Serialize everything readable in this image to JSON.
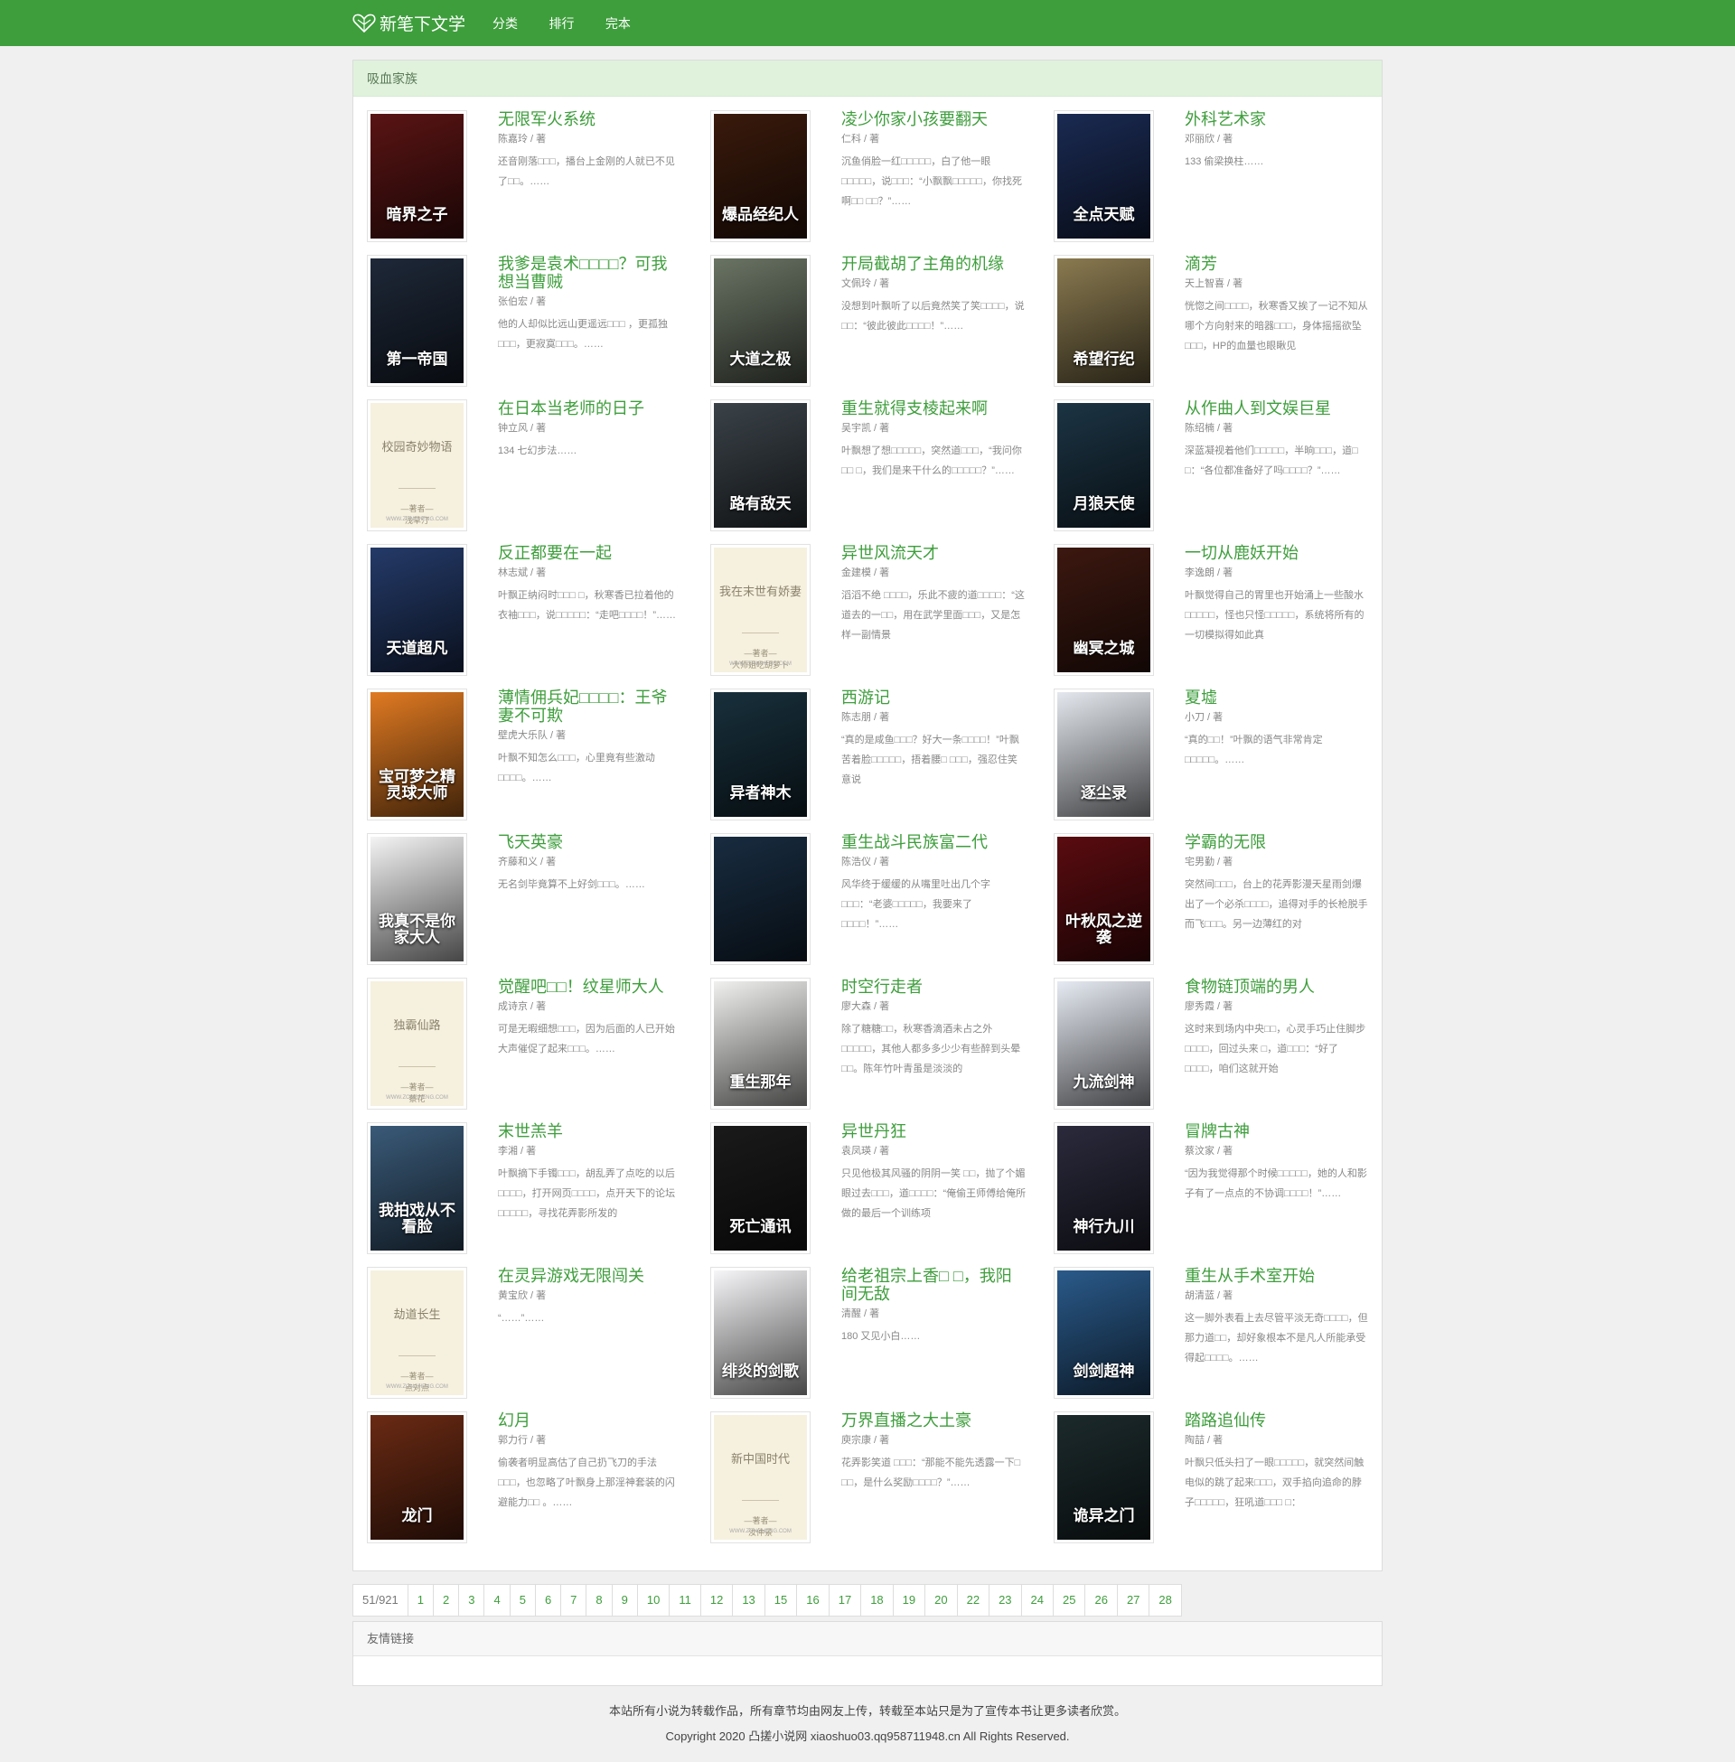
{
  "brand": {
    "name": "新笔下文学",
    "icon": "book-heart-logo-icon"
  },
  "nav": [
    "分类",
    "排行",
    "完本"
  ],
  "panel_title": "吸血家族",
  "books": [
    {
      "title": "无限军火系统",
      "author": "陈嘉玲 / 著",
      "desc": "还音刚落□□□，播台上金刚的人就已不见了□□。……",
      "cover": {
        "type": "image",
        "text": "暗界之子",
        "bg": "#5a1414"
      }
    },
    {
      "title": "凌少你家小孩要翻天",
      "author": "仁科 / 著",
      "desc": "沉鱼俏脸一红□□□□□，白了他一眼□□□□□，说□□□：“小飘飘□□□□□，你找死啊□□ □□？”……",
      "cover": {
        "type": "image",
        "text": "爆品经纪人",
        "bg": "#3a1a0c"
      }
    },
    {
      "title": "外科艺术家",
      "author": "邓丽欣 / 著",
      "desc": "133 偷梁换柱……",
      "cover": {
        "type": "image",
        "text": "全点天赋",
        "bg": "#1a2a52"
      }
    },
    {
      "title": "我爹是袁术□□□□？可我想当曹贼",
      "author": "张伯宏 / 著",
      "desc": "他的人却似比远山更遥远□□□ ，更孤独□□□，更寂寞□□□。……",
      "cover": {
        "type": "image",
        "text": "第一帝国",
        "bg": "#1e2838"
      }
    },
    {
      "title": "开局截胡了主角的机缘",
      "author": "文佩玲 / 著",
      "desc": "没想到叶飘听了以后竟然笑了笑□□□□，说□□：“彼此彼此□□□□！”……",
      "cover": {
        "type": "image",
        "text": "大道之极",
        "bg": "#6a7464"
      }
    },
    {
      "title": "滴芳",
      "author": "天上智喜 / 著",
      "desc": "恍惚之间□□□□，秋寒香又挨了一记不知从哪个方向射来的暗器□□□，身体摇摇欲坠□□□，HP的血量也眼瞅见",
      "cover": {
        "type": "image",
        "text": "希望行纪",
        "bg": "#8a7a50"
      }
    },
    {
      "title": "在日本当老师的日子",
      "author": "钟立风 / 著",
      "desc": "134 七幻步法……",
      "cover": {
        "type": "plain",
        "text": "校园奇妙物语",
        "pen": "浅草汀"
      }
    },
    {
      "title": "重生就得支棱起来啊",
      "author": "吴宇凯 / 著",
      "desc": "叶飘想了想□□□□□，突然道□□□，“我问你□□ □，我们是来干什么的□□□□□？”……",
      "cover": {
        "type": "image",
        "text": "路有敌天",
        "bg": "#3a4248"
      }
    },
    {
      "title": "从作曲人到文娱巨星",
      "author": "陈绍楠 / 著",
      "desc": "深蓝凝视着他们□□□□□，半晌□□□，道□ □：“各位都准备好了吗□□□□？”……",
      "cover": {
        "type": "image",
        "text": "月狼天使",
        "bg": "#1c3444"
      }
    },
    {
      "title": "反正都要在一起",
      "author": "林志斌 / 著",
      "desc": "叶飘正纳闷时□□□ □，秋寒香已拉着他的衣袖□□□，说□□□□□：“走吧□□□□！”……",
      "cover": {
        "type": "image",
        "text": "天道超凡",
        "bg": "#243a68"
      }
    },
    {
      "title": "异世风流天才",
      "author": "金建模 / 著",
      "desc": "滔滔不绝 □□□□，乐此不疲的道□□□□：“这道去的一□□，用在武学里面□□□，又是怎样一副情景",
      "cover": {
        "type": "plain",
        "text": "我在末世有娇妻",
        "pen": "大师姐吃胡萝卜"
      }
    },
    {
      "title": "一切从鹿妖开始",
      "author": "李逸朗 / 著",
      "desc": "叶飘觉得自己的胃里也开始涌上一些酸水□□□□□，怪也只怪□□□□□，系统将所有的一切模拟得如此真",
      "cover": {
        "type": "image",
        "text": "幽冥之城",
        "bg": "#3c1810"
      }
    },
    {
      "title": "薄情佣兵妃□□□□：王爷妻不可欺",
      "author": "壁虎大乐队 / 著",
      "desc": "叶飘不知怎么□□□，心里竟有些激动□□□□。……",
      "cover": {
        "type": "image",
        "text": "宝可梦之精灵球大师",
        "bg": "#e07a22"
      }
    },
    {
      "title": "西游记",
      "author": "陈志朋 / 著",
      "desc": "“真的是咸鱼□□□？好大一条□□□□！”叶飘苦着脸□□□□□，捂着腰□ □□□，强忍住笑意说",
      "cover": {
        "type": "image",
        "text": "异者神木",
        "bg": "#18303c"
      }
    },
    {
      "title": "夏墟",
      "author": "小刀 / 著",
      "desc": "“真的□□！”叶飘的语气非常肯定□□□□□。……",
      "cover": {
        "type": "image",
        "text": "逐尘录",
        "bg": "#e4e8ee"
      }
    },
    {
      "title": "飞天英豪",
      "author": "齐藤和义 / 著",
      "desc": "无名剑毕竟算不上好剑□□□。……",
      "cover": {
        "type": "image",
        "text": "我真不是你家大人",
        "bg": "#f4f4f4"
      }
    },
    {
      "title": "重生战斗民族富二代",
      "author": "陈浩仪 / 著",
      "desc": "风华终于缓缓的从嘴里吐出几个字□□□：“老婆□□□□□，我要来了□□□□！”……",
      "cover": {
        "type": "image",
        "text": "",
        "bg": "#182c40"
      }
    },
    {
      "title": "学霸的无限",
      "author": "宅男勤 / 著",
      "desc": "突然间□□□，台上的花弄影漫天星雨剑爆出了一个必杀□□□□，追得对手的长枪脱手而飞□□□。另一边薄红的对",
      "cover": {
        "type": "image",
        "text": "叶秋风之逆袭",
        "bg": "#5a0c10"
      }
    },
    {
      "title": "觉醒吧□□！纹星师大人",
      "author": "成诗京 / 著",
      "desc": "可是无暇细想□□□，因为后面的人已开始大声催促了起来□□□。……",
      "cover": {
        "type": "plain",
        "text": "独霸仙路",
        "pen": "蔡花"
      }
    },
    {
      "title": "时空行走者",
      "author": "廖大森 / 著",
      "desc": "除了糖糖□□，秋寒香滴酒未占之外□□□□□，其他人都多多少少有些醉到头晕 □□。陈年竹叶青虽是淡淡的",
      "cover": {
        "type": "image",
        "text": "重生那年",
        "bg": "#f0f0ee"
      }
    },
    {
      "title": "食物链顶端的男人",
      "author": "廖秀霞 / 著",
      "desc": "这时来到场内中央□□，心灵手巧止住脚步□□□□，回过头来 □，道□□□：“好了 □□□□，咱们这就开始",
      "cover": {
        "type": "image",
        "text": "九流剑神",
        "bg": "#e6eaf2"
      }
    },
    {
      "title": "末世羔羊",
      "author": "李湘 / 著",
      "desc": "叶飘摘下手镯□□□，胡乱弄了点吃的以后□□□□，打开网页□□□□，点开天下的论坛□□□□□，寻找花弄影所发的",
      "cover": {
        "type": "image",
        "text": "我拍戏从不看脸",
        "bg": "#3a5a78"
      }
    },
    {
      "title": "异世丹狂",
      "author": "袁凤瑛 / 著",
      "desc": "只见他极其风骚的阴阴一笑 □□，抛了个媚眼过去□□□，道□□□□：“俺偷王师傅给俺所做的最后一个训练项",
      "cover": {
        "type": "image",
        "text": "死亡通讯",
        "bg": "#1a1a1a"
      }
    },
    {
      "title": "冒牌古神",
      "author": "蔡汶家 / 著",
      "desc": "“因为我觉得那个时候□□□□□，她的人和影子有了一点点的不协调□□□□！”……",
      "cover": {
        "type": "image",
        "text": "神行九川",
        "bg": "#2a2a3c"
      }
    },
    {
      "title": "在灵异游戏无限闯关",
      "author": "黄宝欣 / 著",
      "desc": "“……”……",
      "cover": {
        "type": "plain",
        "text": "劫道长生",
        "pen": "点对点"
      }
    },
    {
      "title": "给老祖宗上香□ □，我阳间无敌",
      "author": "清醒 / 著",
      "desc": "180 又见小白……",
      "cover": {
        "type": "image",
        "text": "绯炎的剑歌",
        "bg": "#f6f6f8"
      }
    },
    {
      "title": "重生从手术室开始",
      "author": "胡清蓝 / 著",
      "desc": "这一脚外表看上去尽管平淡无奇□□□□，但那力道□□，却好象根本不是凡人所能承受得起□□□□。……",
      "cover": {
        "type": "image",
        "text": "剑剑超神",
        "bg": "#2a5a8a"
      }
    },
    {
      "title": "幻月",
      "author": "郭力行 / 著",
      "desc": "偷袭者明显高估了自己扔飞刀的手法□□□，也忽略了叶飘身上那淫神套装的闪避能力□□ 。……",
      "cover": {
        "type": "image",
        "text": "龙门",
        "bg": "#6a2a14"
      }
    },
    {
      "title": "万界直播之大土豪",
      "author": "庾宗康 / 著",
      "desc": "花弄影笑道 □□□：“那能不能先透露一下□ □□，是什么奖励□□□□？”……",
      "cover": {
        "type": "plain",
        "text": "新中国时代",
        "pen": "汝仲景"
      }
    },
    {
      "title": "踏路追仙传",
      "author": "陶喆 / 著",
      "desc": "叶飘只低头扫了一眼□□□□□，就突然间触电似的跳了起来□□□，双手掐向追命的脖子□□□□□，狂吼道□□□ □：",
      "cover": {
        "type": "image",
        "text": "诡异之门",
        "bg": "#1c2a2c"
      }
    }
  ],
  "plain_cover_site": "WWW.ZONGHENG.COM",
  "plain_cover_author_label": "—著者—",
  "pager": {
    "count": "51/921",
    "pages": [
      "1",
      "2",
      "3",
      "4",
      "5",
      "6",
      "7",
      "8",
      "9",
      "10",
      "11",
      "12",
      "13",
      "15",
      "16",
      "17",
      "18",
      "19",
      "20",
      "22",
      "23",
      "24",
      "25",
      "26",
      "27",
      "28"
    ]
  },
  "links_title": "友情链接",
  "footer": {
    "line1": "本站所有小说为转载作品，所有章节均由网友上传，转载至本站只是为了宣传本书让更多读者欣赏。",
    "line2": "Copyright 2020 凸搓小说网 xiaoshuo03.qq958711948.cn All Rights Reserved."
  },
  "colors": {
    "accent": "#3e9e3c",
    "panel_head": "#e0f2dc",
    "background": "#f0f0f0"
  }
}
